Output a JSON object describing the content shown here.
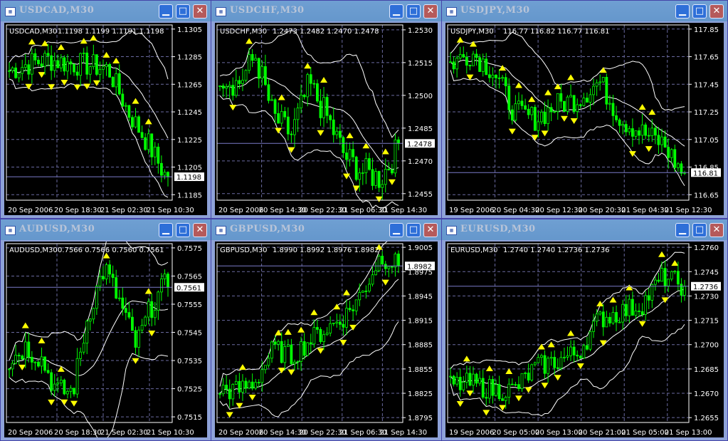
{
  "windows": [
    {
      "title": "USDCAD,M30",
      "symbol_line": "USDCAD,M30",
      "ohlc": "1.1198 1.1199 1.1191 1.1198",
      "price_ticks": [
        "1.1305",
        "1.1285",
        "1.1265",
        "1.1245",
        "1.1225",
        "1.1205",
        "1.1185"
      ],
      "current_price": "1.1198",
      "time_ticks": [
        "20 Sep 2006",
        "20 Sep 18:30",
        "21 Sep 02:30",
        "21 Sep 10:30"
      ],
      "trend": [
        1.1275,
        1.128,
        1.1283,
        1.128,
        1.1279,
        1.1276,
        1.1245,
        1.1222,
        1.1195
      ]
    },
    {
      "title": "USDCHF,M30",
      "symbol_line": "USDCHF,M30",
      "ohlc": "1.2473 1.2482 1.2470 1.2478",
      "price_ticks": [
        "1.2530",
        "1.2515",
        "1.2500",
        "1.2485",
        "1.2470",
        "1.2455"
      ],
      "current_price": "1.2478",
      "time_ticks": [
        "20 Sep 2006",
        "20 Sep 14:30",
        "20 Sep 22:30",
        "21 Sep 06:30",
        "21 Sep 14:30"
      ],
      "trend": [
        1.251,
        1.2505,
        1.2518,
        1.249,
        1.2482,
        1.2505,
        1.249,
        1.2472,
        1.2465,
        1.2462,
        1.2476
      ]
    },
    {
      "title": "USDJPY,M30",
      "symbol_line": "USDJPY,M30",
      "ohlc": "116.77 116.82 116.77 116.81",
      "price_ticks": [
        "117.85",
        "117.65",
        "117.45",
        "117.25",
        "117.05",
        "116.85",
        "116.65"
      ],
      "current_price": "116.81",
      "time_ticks": [
        "19 Sep 2006",
        "20 Sep 04:30",
        "20 Sep 12:30",
        "20 Sep 20:30",
        "21 Sep 04:30",
        "21 Sep 12:30"
      ],
      "trend": [
        117.6,
        117.68,
        117.55,
        117.25,
        117.2,
        117.3,
        117.35,
        117.47,
        117.2,
        117.1,
        117.02,
        116.78
      ]
    },
    {
      "title": "AUDUSD,M30",
      "symbol_line": "AUDUSD,M30",
      "ohlc": "0.7566 0.7566 0.7560 0.7561",
      "price_ticks": [
        "0.7575",
        "0.7565",
        "0.7555",
        "0.7545",
        "0.7535",
        "0.7525",
        "0.7515"
      ],
      "current_price": "0.7561",
      "time_ticks": [
        "20 Sep 2006",
        "20 Sep 18:30",
        "21 Sep 02:30",
        "21 Sep 10:30"
      ],
      "trend": [
        0.7535,
        0.754,
        0.7536,
        0.7524,
        0.7524,
        0.7552,
        0.7568,
        0.7555,
        0.754,
        0.7555,
        0.7563
      ]
    },
    {
      "title": "GBPUSD,M30",
      "symbol_line": "GBPUSD,M30",
      "ohlc": "1.8990 1.8992 1.8976 1.8982",
      "price_ticks": [
        "1.9005",
        "1.8975",
        "1.8945",
        "1.8915",
        "1.8885",
        "1.8855",
        "1.8825",
        "1.8795"
      ],
      "current_price": "1.8982",
      "time_ticks": [
        "20 Sep 2006",
        "20 Sep 14:30",
        "20 Sep 22:30",
        "21 Sep 06:30",
        "21 Sep 14:30"
      ],
      "trend": [
        1.883,
        1.8828,
        1.884,
        1.888,
        1.887,
        1.889,
        1.8905,
        1.892,
        1.895,
        1.8995,
        1.8982
      ]
    },
    {
      "title": "EURUSD,M30",
      "symbol_line": "EURUSD,M30",
      "ohlc": "1.2740 1.2740 1.2736 1.2736",
      "price_ticks": [
        "1.2760",
        "1.2745",
        "1.2730",
        "1.2715",
        "1.2700",
        "1.2685",
        "1.2670",
        "1.2655"
      ],
      "current_price": "1.2736",
      "time_ticks": [
        "19 Sep 2006",
        "20 Sep 05:00",
        "20 Sep 13:00",
        "20 Sep 21:00",
        "21 Sep 05:00",
        "21 Sep 13:00"
      ],
      "trend": [
        1.2675,
        1.2676,
        1.2672,
        1.2672,
        1.2686,
        1.269,
        1.2695,
        1.2716,
        1.272,
        1.2725,
        1.2742,
        1.2736
      ]
    }
  ],
  "colors": {
    "bull": "#00ff00",
    "bear": "#ffffff",
    "bands": "#ffffff",
    "fractal": "#ffff00",
    "grid": "#6a6aa0",
    "background": "#000000"
  },
  "icons": {
    "window": "chart-window-icon",
    "minimize": "minimize-icon",
    "maximize": "maximize-icon",
    "close": "close-icon",
    "fractal": "fractal-arrow-icon"
  }
}
